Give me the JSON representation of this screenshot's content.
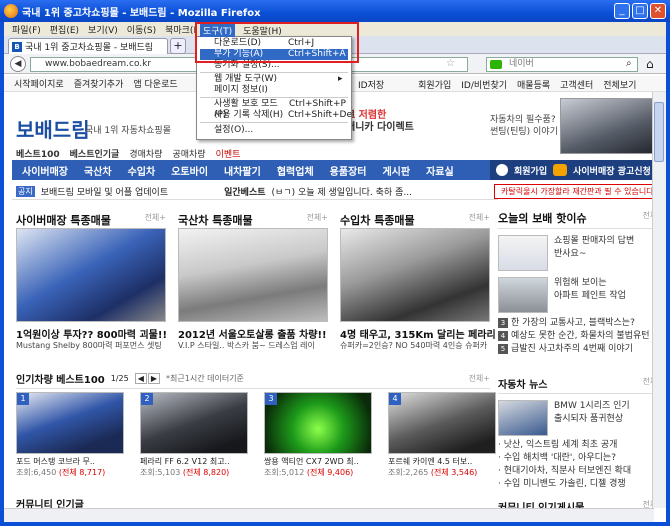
{
  "window": {
    "title": "국내 1위 중고차쇼핑몰 - 보배드림 - Mozilla Firefox"
  },
  "menubar": [
    "파일(F)",
    "편집(E)",
    "보기(V)",
    "이동(S)",
    "북마크(B)"
  ],
  "tab": {
    "icon": "B",
    "label": "국내 1위 중고차쇼핑몰 - 보배드림",
    "new": "+"
  },
  "nav": {
    "url": "www.bobaedream.co.kr",
    "search_placeholder": "네이버"
  },
  "bookmarks": [
    "시작페이지로",
    "즐겨찾기추가",
    "앱 다운로드"
  ],
  "toplinks": [
    "ID저장",
    "회원가입",
    "ID/비번찾기",
    "매물등록",
    "고객센터",
    "전체보기"
  ],
  "tools_menu": {
    "headers": [
      "도구(T)",
      "도움말(H)"
    ],
    "items": [
      {
        "label": "다운로드(D)",
        "shortcut": "Ctrl+J"
      },
      {
        "label": "부가 기능(A)",
        "shortcut": "Ctrl+Shift+A",
        "selected": true
      },
      {
        "label": "동기화 설정(S)...",
        "shortcut": ""
      },
      {
        "label": "웹 개발 도구(W)",
        "shortcut": "▸"
      },
      {
        "label": "페이지 정보(I)",
        "shortcut": ""
      },
      {
        "label": "사생활 보호 모드(P)",
        "shortcut": "Ctrl+Shift+P"
      },
      {
        "label": "사용 기록 삭제(H)",
        "shortcut": "Ctrl+Shift+Del"
      },
      {
        "label": "설정(O)...",
        "shortcut": ""
      }
    ]
  },
  "site": {
    "logo": "보배드림",
    "logo_sub": "국내 1위 자동차쇼핑몰",
    "promo_line1": "로 저렴한",
    "promo_line2": "애니카 다이렉트",
    "ad_line1": "자동차의 필수품?",
    "ad_line2": "썬팅(틴팅) 이야기",
    "categories": [
      "베스트100",
      "베스트인기글",
      "경매차량",
      "공매차량",
      "이벤트"
    ],
    "nav": [
      "사이버매장",
      "국산차",
      "수입차",
      "오토바이",
      "내차팔기",
      "협력업체",
      "용품장터",
      "게시판",
      "자료실"
    ],
    "nav_right": [
      "회원가입",
      "사이버매장 광고신청"
    ],
    "notice_tag": "공지",
    "notice": "보배드림 모바일 및 어플 업데이트",
    "notice2": "일간베스트",
    "notice3": "(ㅂㄱ) 오늘 제 생일입니다. 축하 좀...",
    "red_badge": "카탈릭울시 가장할라 재간판과 필 수 있습니다."
  },
  "featured": [
    {
      "section": "사이버매장 특종매물",
      "more": "전체+",
      "title": "1억원이상 투자?? 800마력 괴물!!",
      "sub": "Mustang Shelby 800마력 퍼포먼스 셋팅"
    },
    {
      "section": "국산차 특종매물",
      "more": "전체+",
      "title": "2012년 서울오토살롱 출품 차량!!",
      "sub": "V.I.P 스타일.. 박스카 붐~ 드레스업 레이"
    },
    {
      "section": "수입차 특종매물",
      "more": "전체+",
      "title": "4명 태우고, 315Km 달리는 페라리",
      "sub": "슈퍼카=2인승? NO 540마력 4인승 슈퍼카"
    }
  ],
  "right": {
    "title": "오늘의 보배 핫이슈",
    "more": "전체+",
    "issues": [
      {
        "text1": "쇼핑몰 판매자의 답변",
        "text2": "반사요~"
      },
      {
        "text1": "위험해 보이는",
        "text2": "아파트 페인트 작업"
      }
    ],
    "list": [
      {
        "n": "3",
        "text": "한 가장의 교통사고, 블랙박스는?"
      },
      {
        "n": "4",
        "text": "예상도 못한 순간, 화물차의 불법유턴"
      },
      {
        "n": "5",
        "text": "급발진 사고차주의 4번째 이야기"
      }
    ],
    "news_title": "자동차 뉴스",
    "news_more": "전체+",
    "news_thumb_text1": "BMW 1시리즈 인기",
    "news_thumb_text2": "출시되자 품귀현상",
    "news": [
      "낫산, 익스트림 세계 최초 공개",
      "수입 해치백 '대란', 아우디는?",
      "현대기아차, 직분사 터보엔진 확대",
      "수입 미니밴도 가솔린, 디젤 경쟁"
    ],
    "community": "커뮤니티 인기게시물",
    "community_more": "전체+"
  },
  "best100": {
    "title": "인기차량 베스트100",
    "page": "1/25",
    "note": "*최근1시간 데이터기준",
    "more": "전체+",
    "cars": [
      {
        "n": "1",
        "name": "포드 머스탱 코브라 무..",
        "views": "조회:6,450",
        "count": "(전체 8,717)"
      },
      {
        "n": "2",
        "name": "페라리 FF 6.2 V12 최고..",
        "views": "조회:5,103",
        "count": "(전체 8,820)"
      },
      {
        "n": "3",
        "name": "쌍용 액티언 CX7 2WD 최..",
        "views": "조회:5,012",
        "count": "(전체 9,406)"
      },
      {
        "n": "4",
        "name": "포르쉐 카이엔 4.5 터보..",
        "views": "조회:2,265",
        "count": "(전체 3,546)"
      }
    ]
  },
  "community_left": "커뮤니티 인기글"
}
